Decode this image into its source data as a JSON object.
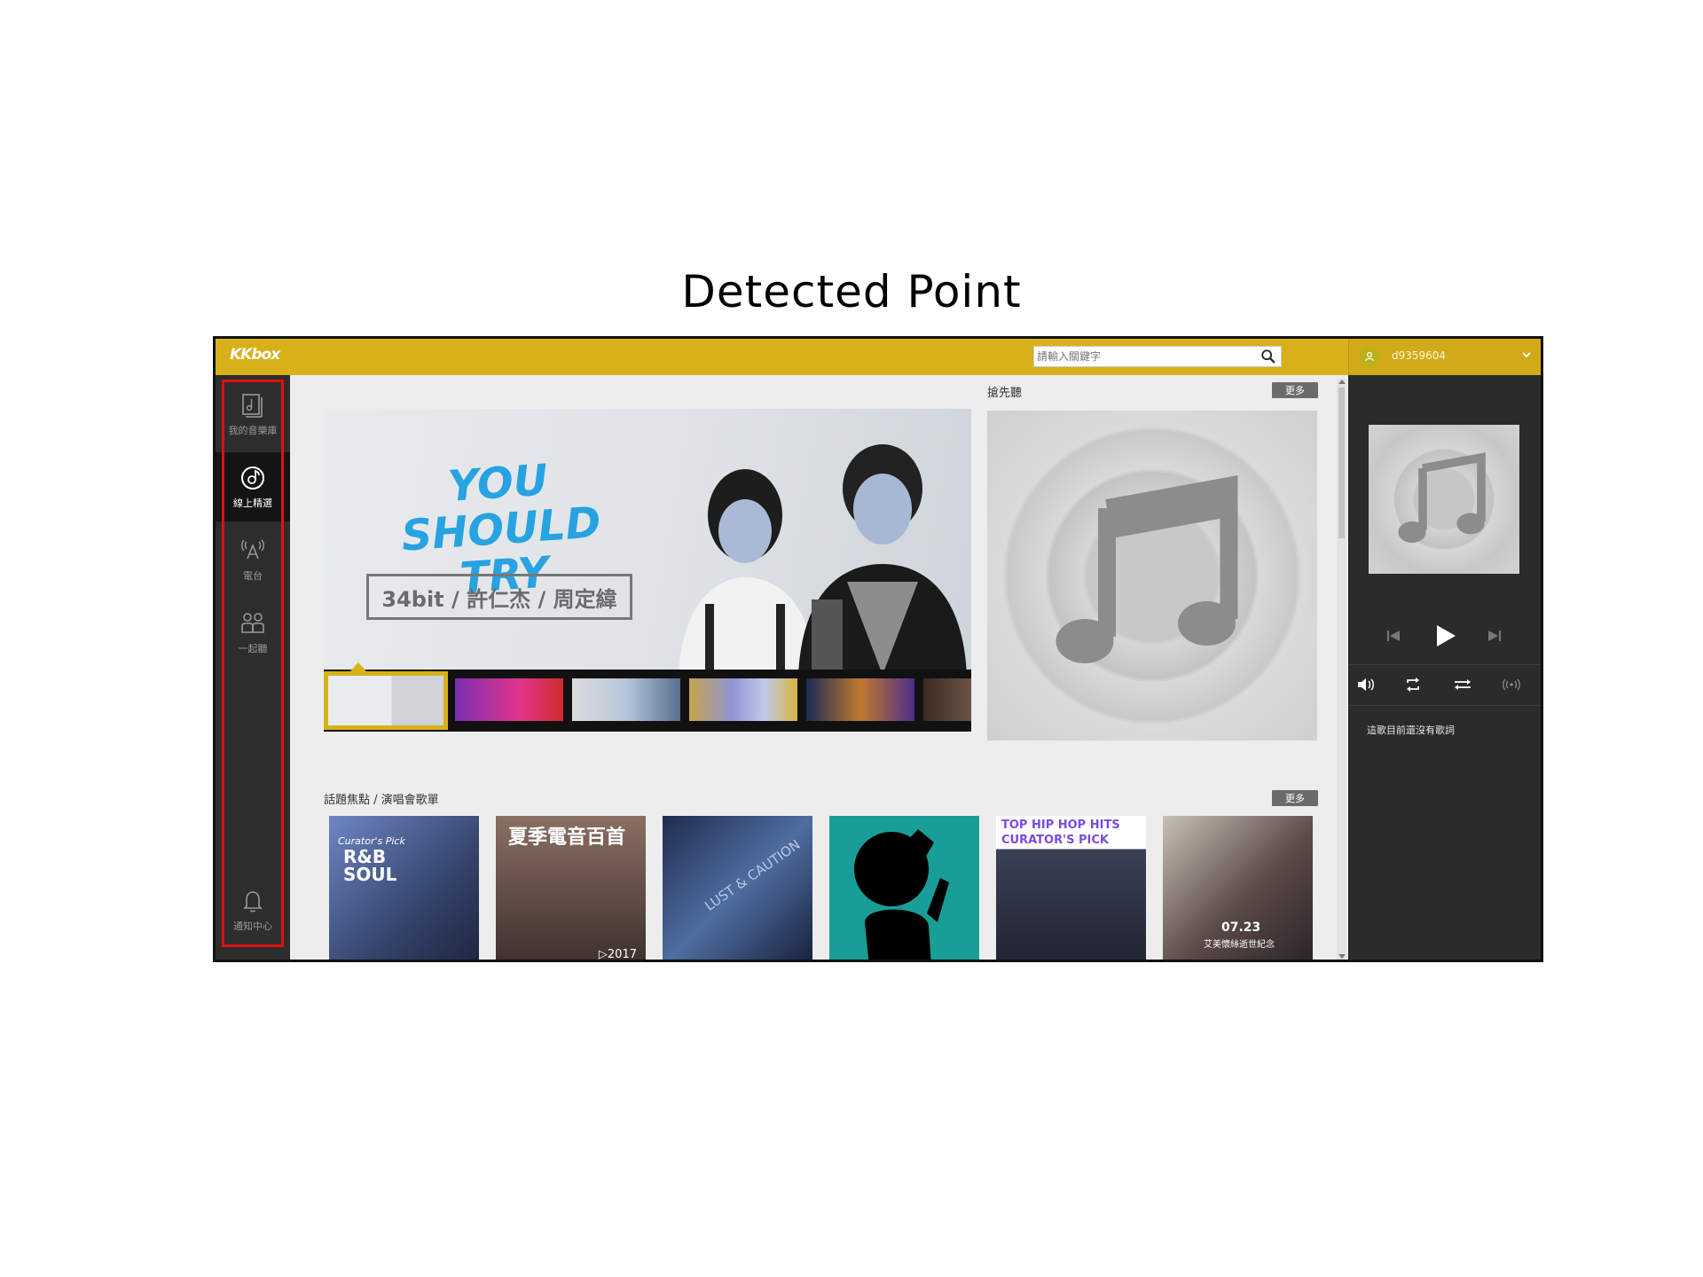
{
  "figure": {
    "title": "Detected Point"
  },
  "header": {
    "logo": "KKbox",
    "search_placeholder": "請輸入關鍵字",
    "username": "d9359604"
  },
  "leftnav": {
    "items": [
      {
        "label": "我的音樂庫",
        "icon": "music-library-icon"
      },
      {
        "label": "線上精選",
        "icon": "disc-icon",
        "active": true
      },
      {
        "label": "電台",
        "icon": "radio-tower-icon"
      },
      {
        "label": "一起聽",
        "icon": "listen-together-icon"
      }
    ],
    "notification_label": "通知中心"
  },
  "banner": {
    "title": "YOU SHOULD TRY",
    "artists": "34bit / 許仁杰 / 周定緯"
  },
  "preview": {
    "label": "搶先聽",
    "more": "更多"
  },
  "topics": {
    "label": "話題焦點 / 演唱會歌單",
    "more": "更多",
    "cards": [
      {
        "text": "R&B SOUL",
        "subtext": "Curator's Pick"
      },
      {
        "text": "夏季電音百首",
        "subtext": "▷2017"
      },
      {
        "text": "LUST & CAUTION",
        "subtext": ""
      },
      {
        "text": "",
        "subtext": ""
      },
      {
        "text": "TOP HIP HOP HITS",
        "subtext": "CURATOR'S PICK"
      },
      {
        "text": "07.23",
        "subtext": "艾美懷絲逝世紀念"
      }
    ]
  },
  "player": {
    "lyrics_message": "這歌目前還沒有歌詞"
  },
  "colors": {
    "brand_yellow": "#d8b01a",
    "nav_bg": "#2d2d2d",
    "player_bg": "#2b2b2b",
    "highlight_red": "#e01010"
  }
}
